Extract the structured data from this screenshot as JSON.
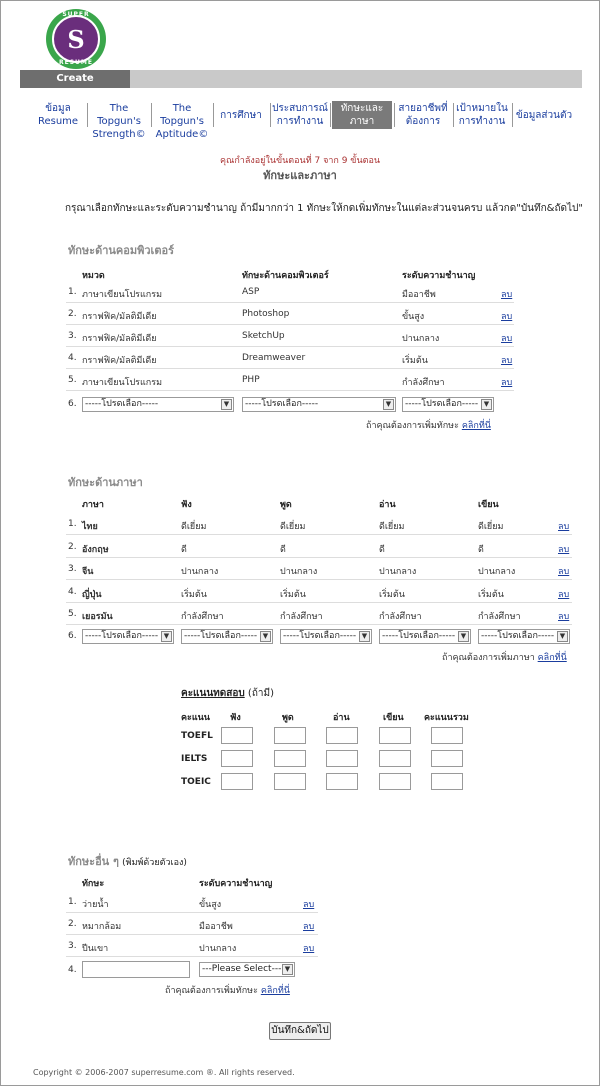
{
  "logo": {
    "letter": "S",
    "top_text": "SUPER",
    "bottom_text": "RESUME"
  },
  "header_bar": {
    "label": "Create SuperResume"
  },
  "nav": [
    {
      "label": "ข้อมูล\nResume"
    },
    {
      "label": "The Topgun's\nStrength©"
    },
    {
      "label": "The Topgun's\nAptitude©"
    },
    {
      "label": "การศึกษา"
    },
    {
      "label": "ประสบการณ์\nการทำงาน"
    },
    {
      "label": "ทักษะและ\nภาษา",
      "active": true
    },
    {
      "label": "สายอาชีพที่\nต้องการ"
    },
    {
      "label": "เป้าหมายใน\nการทำงาน"
    },
    {
      "label": "ข้อมูลส่วนตัว"
    }
  ],
  "step_text": "คุณกำลังอยู่ในขั้นตอนที่ 7 จาก 9 ขั้นตอน",
  "step_title": "ทักษะและภาษา",
  "instruction": "กรุณาเลือกทักษะและระดับความชำนาญ ถ้ามีมากกว่า 1 ทักษะให้กดเพิ่มทักษะในแต่ละส่วนจนครบ แล้วกด\"บันทึก&ถัดไป\"",
  "computer": {
    "title": "ทักษะด้านคอมพิวเตอร์",
    "headers": [
      "หมวด",
      "ทักษะด้านคอมพิวเตอร์",
      "ระดับความชำนาญ"
    ],
    "rows": [
      {
        "num": "1.",
        "category": "ภาษาเขียนโปรแกรม",
        "skill": "ASP",
        "level": "มืออาชีพ",
        "delete": "ลบ"
      },
      {
        "num": "2.",
        "category": "กราฟฟิค/มัลติมีเดีย",
        "skill": "Photoshop",
        "level": "ขั้นสูง",
        "delete": "ลบ"
      },
      {
        "num": "3.",
        "category": "กราฟฟิค/มัลติมีเดีย",
        "skill": "SketchUp",
        "level": "ปานกลาง",
        "delete": "ลบ"
      },
      {
        "num": "4.",
        "category": "กราฟฟิค/มัลติมีเดีย",
        "skill": "Dreamweaver",
        "level": "เริ่มต้น",
        "delete": "ลบ"
      },
      {
        "num": "5.",
        "category": "ภาษาเขียนโปรแกรม",
        "skill": "PHP",
        "level": "กำลังศึกษา",
        "delete": "ลบ"
      }
    ],
    "new_num": "6.",
    "select_placeholder": "-----โปรดเลือก-----",
    "add_prompt": "ถ้าคุณต้องการเพิ่มทักษะ",
    "add_link": "คลิกที่นี่"
  },
  "language": {
    "title": "ทักษะด้านภาษา",
    "headers": [
      "ภาษา",
      "ฟัง",
      "พูด",
      "อ่าน",
      "เขียน"
    ],
    "rows": [
      {
        "num": "1.",
        "lang": "ไทย",
        "listen": "ดีเยี่ยม",
        "speak": "ดีเยี่ยม",
        "read": "ดีเยี่ยม",
        "write": "ดีเยี่ยม",
        "delete": "ลบ"
      },
      {
        "num": "2.",
        "lang": "อังกฤษ",
        "listen": "ดี",
        "speak": "ดี",
        "read": "ดี",
        "write": "ดี",
        "delete": "ลบ"
      },
      {
        "num": "3.",
        "lang": "จีน",
        "listen": "ปานกลาง",
        "speak": "ปานกลาง",
        "read": "ปานกลาง",
        "write": "ปานกลาง",
        "delete": "ลบ"
      },
      {
        "num": "4.",
        "lang": "ญี่ปุ่น",
        "listen": "เริ่มต้น",
        "speak": "เริ่มต้น",
        "read": "เริ่มต้น",
        "write": "เริ่มต้น",
        "delete": "ลบ"
      },
      {
        "num": "5.",
        "lang": "เยอรมัน",
        "listen": "กำลังศึกษา",
        "speak": "กำลังศึกษา",
        "read": "กำลังศึกษา",
        "write": "กำลังศึกษา",
        "delete": "ลบ"
      }
    ],
    "new_num": "6.",
    "select_placeholder": "-----โปรดเลือก-----",
    "add_prompt": "ถ้าคุณต้องการเพิ่มภาษา",
    "add_link": "คลิกที่นี่"
  },
  "test": {
    "title": "คะแนนทดสอบ",
    "optional": "(ถ้ามี)",
    "headers": [
      "คะแนน",
      "ฟัง",
      "พูด",
      "อ่าน",
      "เขียน",
      "คะแนนรวม"
    ],
    "rows": [
      "TOEFL",
      "IELTS",
      "TOEIC"
    ]
  },
  "other": {
    "title": "ทักษะอื่น ๆ",
    "note": "(พิมพ์ด้วยตัวเอง)",
    "headers": [
      "ทักษะ",
      "ระดับความชำนาญ"
    ],
    "rows": [
      {
        "num": "1.",
        "skill": "ว่ายน้ำ",
        "level": "ขั้นสูง",
        "delete": "ลบ"
      },
      {
        "num": "2.",
        "skill": "หมากล้อม",
        "level": "มืออาชีพ",
        "delete": "ลบ"
      },
      {
        "num": "3.",
        "skill": "ปีนเขา",
        "level": "ปานกลาง",
        "delete": "ลบ"
      }
    ],
    "new_num": "4.",
    "select_placeholder": "---Please Select---",
    "add_prompt": "ถ้าคุณต้องการเพิ่มทักษะ",
    "add_link": "คลิกที่นี่"
  },
  "submit_label": "บันทึก&ถัดไป",
  "copyright": "Copyright © 2006-2007 superresume.com ®. All rights reserved."
}
